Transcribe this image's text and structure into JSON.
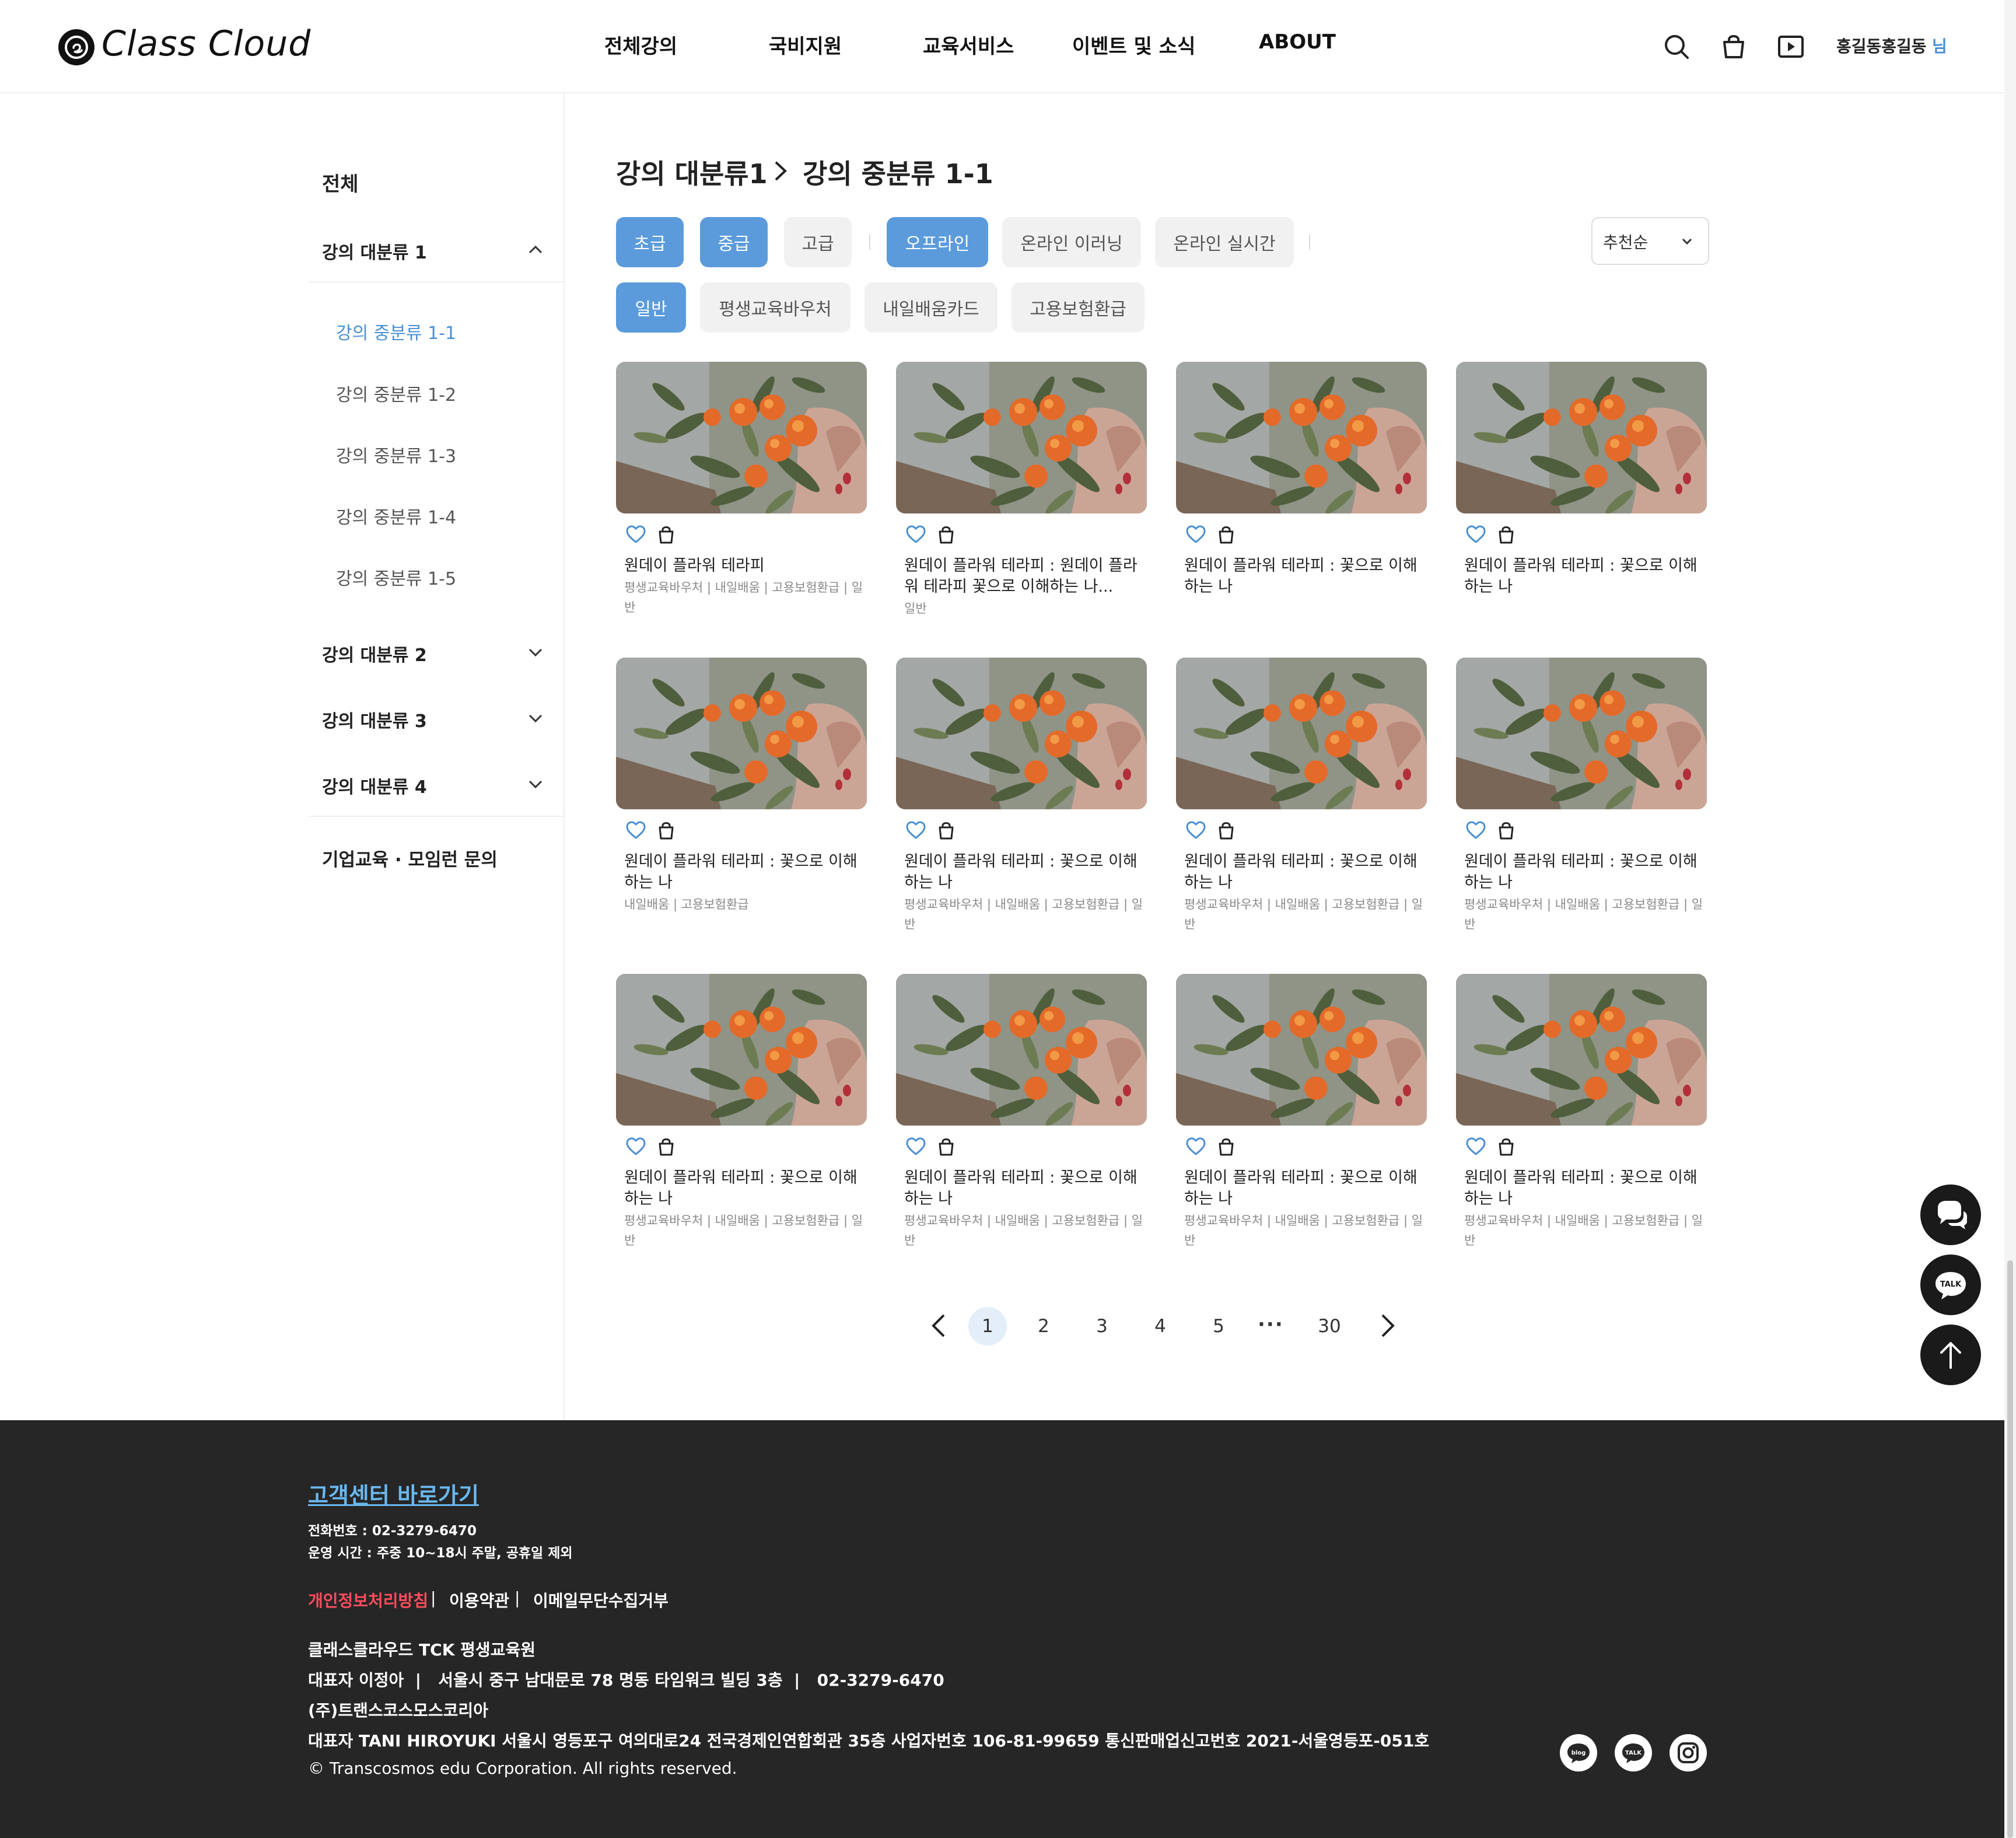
{
  "brand": {
    "name": "Class Cloud"
  },
  "nav": {
    "items": [
      {
        "label": "전체강의"
      },
      {
        "label": "국비지원"
      },
      {
        "label": "교육서비스"
      },
      {
        "label": "이벤트 및 소식"
      },
      {
        "label": "ABOUT"
      }
    ]
  },
  "header_icons": [
    "search-icon",
    "cart-icon",
    "video-icon"
  ],
  "user": {
    "name": "홍길동홍길동",
    "suffix": "님"
  },
  "sidebar": {
    "all": "전체",
    "categories": [
      {
        "label": "강의 대분류 1",
        "expanded": true
      },
      {
        "label": "강의 대분류 2",
        "expanded": false
      },
      {
        "label": "강의 대분류 3",
        "expanded": false
      },
      {
        "label": "강의 대분류 4",
        "expanded": false
      }
    ],
    "subcategories": [
      {
        "label": "강의 중분류 1-1",
        "active": true
      },
      {
        "label": "강의 중분류 1-2",
        "active": false
      },
      {
        "label": "강의 중분류 1-3",
        "active": false
      },
      {
        "label": "강의 중분류 1-4",
        "active": false
      },
      {
        "label": "강의 중분류 1-5",
        "active": false
      }
    ],
    "corporate": "기업교육 · 모임런 문의"
  },
  "breadcrumb": {
    "level1": "강의 대분류1",
    "level2": "강의 중분류 1-1"
  },
  "filters": {
    "level": [
      {
        "label": "초급",
        "selected": true
      },
      {
        "label": "중급",
        "selected": true
      },
      {
        "label": "고급",
        "selected": false
      }
    ],
    "format": [
      {
        "label": "오프라인",
        "selected": true
      },
      {
        "label": "온라인 이러닝",
        "selected": false
      },
      {
        "label": "온라인 실시간",
        "selected": false
      }
    ],
    "support": [
      {
        "label": "일반",
        "selected": true
      },
      {
        "label": "평생교육바우처",
        "selected": false
      },
      {
        "label": "내일배움카드",
        "selected": false
      },
      {
        "label": "고용보험환급",
        "selected": false
      }
    ]
  },
  "sort": {
    "selected": "추천순"
  },
  "courses": [
    {
      "title": "원데이 플라워 테라피",
      "tags": "평생교육바우처 | 내일배움 | 고용보험환급 | 일반"
    },
    {
      "title": "원데이 플라워 테라피 : 원데이 플라워 테라피 꽃으로 이해하는 나...",
      "tags": "일반"
    },
    {
      "title": "원데이 플라워 테라피 : 꽃으로 이해하는 나",
      "tags": ""
    },
    {
      "title": "원데이 플라워 테라피 : 꽃으로 이해하는 나",
      "tags": ""
    },
    {
      "title": "원데이 플라워 테라피 : 꽃으로 이해하는 나",
      "tags": "내일배움 | 고용보험환급"
    },
    {
      "title": "원데이 플라워 테라피 : 꽃으로 이해하는 나",
      "tags": "평생교육바우처 | 내일배움 | 고용보험환급 | 일반"
    },
    {
      "title": "원데이 플라워 테라피 : 꽃으로 이해하는 나",
      "tags": "평생교육바우처 | 내일배움 | 고용보험환급 | 일반"
    },
    {
      "title": "원데이 플라워 테라피 : 꽃으로 이해하는 나",
      "tags": "평생교육바우처 | 내일배움 | 고용보험환급 | 일반"
    },
    {
      "title": "원데이 플라워 테라피 : 꽃으로 이해하는 나",
      "tags": "평생교육바우처 | 내일배움 | 고용보험환급 | 일반"
    },
    {
      "title": "원데이 플라워 테라피 : 꽃으로 이해하는 나",
      "tags": "평생교육바우처 | 내일배움 | 고용보험환급 | 일반"
    },
    {
      "title": "원데이 플라워 테라피 : 꽃으로 이해하는 나",
      "tags": "평생교육바우처 | 내일배움 | 고용보험환급 | 일반"
    },
    {
      "title": "원데이 플라워 테라피 : 꽃으로 이해하는 나",
      "tags": "평생교육바우처 | 내일배움 | 고용보험환급 | 일반"
    }
  ],
  "pagination": {
    "current": "1",
    "pages": [
      "1",
      "2",
      "3",
      "4",
      "5"
    ],
    "ellipsis": "···",
    "last": "30"
  },
  "floating": [
    "chat-icon",
    "kakao-talk-icon",
    "arrow-up-icon"
  ],
  "footer": {
    "cs_link": "고객센터 바로가기",
    "phone": "전화번호 : 02-3279-6470",
    "hours": "운영 시간 : 주중 10~18시 주말, 공휴일 제외",
    "links": [
      "개인정보처리방침",
      "이용약관",
      "이메일무단수집거부"
    ],
    "company1": "클래스클라우드 TCK 평생교육원",
    "company1_info": "대표자 이정아  |   서울시 중구 남대문로 78 명동 타임워크 빌딩 3층  |   02-3279-6470",
    "company2": "(주)트랜스코스모스코리아",
    "company2_info": "대표자 TANI HIROYUKI 서울시 영등포구 여의대로24 전국경제인연합회관 35층 사업자번호 106-81-99659 통신판매업신고번호 2021-서울영등포-051호",
    "copyright": "© Transcosmos edu Corporation. All rights reserved.",
    "sns": [
      {
        "label": "blog"
      },
      {
        "label": "TALK"
      },
      {
        "icon": "instagram-icon"
      }
    ]
  },
  "colors": {
    "accent": "#5b9bdb",
    "accent_text": "#4a8fd4",
    "footer_bg": "#262626",
    "footer_link_highlight": "#ff4d5e",
    "cs_link": "#6ab8f0",
    "floating_bg": "#1a1a1a"
  }
}
